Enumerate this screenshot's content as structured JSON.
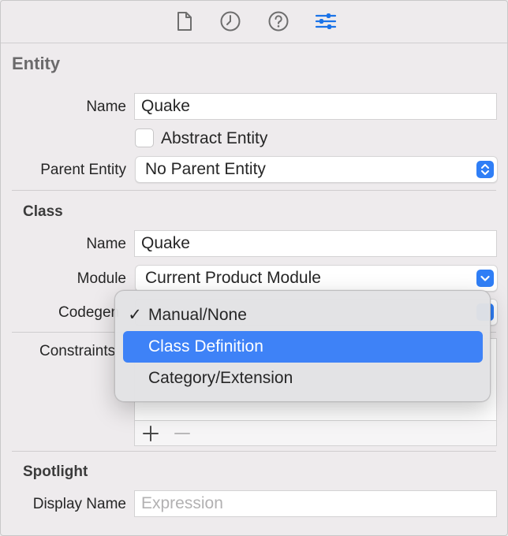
{
  "toolbar": {
    "tabs": [
      {
        "icon": "file-icon"
      },
      {
        "icon": "history-clock-icon"
      },
      {
        "icon": "help-question-icon"
      },
      {
        "icon": "sliders-icon",
        "active": true
      }
    ],
    "accent": "#1a73e8"
  },
  "entity": {
    "title": "Entity",
    "name_label": "Name",
    "name_value": "Quake",
    "abstract_label": "Abstract Entity",
    "abstract_checked": false,
    "parent_label": "Parent Entity",
    "parent_value": "No Parent Entity"
  },
  "class": {
    "title": "Class",
    "name_label": "Name",
    "name_value": "Quake",
    "module_label": "Module",
    "module_value": "Current Product Module",
    "codegen_label": "Codegen",
    "constraints_label": "Constraints"
  },
  "constraints_footer": {
    "add_icon": "plus-icon",
    "remove_icon": "minus-icon"
  },
  "spotlight": {
    "title": "Spotlight",
    "display_name_label": "Display Name",
    "display_name_placeholder": "Expression"
  },
  "codegen_menu": {
    "items": [
      {
        "label": "Manual/None",
        "checked": true,
        "highlighted": false
      },
      {
        "label": "Class Definition",
        "checked": false,
        "highlighted": true
      },
      {
        "label": "Category/Extension",
        "checked": false,
        "highlighted": false
      }
    ],
    "check_glyph": "✓"
  },
  "colors": {
    "highlight": "#3e82f7",
    "stepper": "#2f7ef6"
  }
}
